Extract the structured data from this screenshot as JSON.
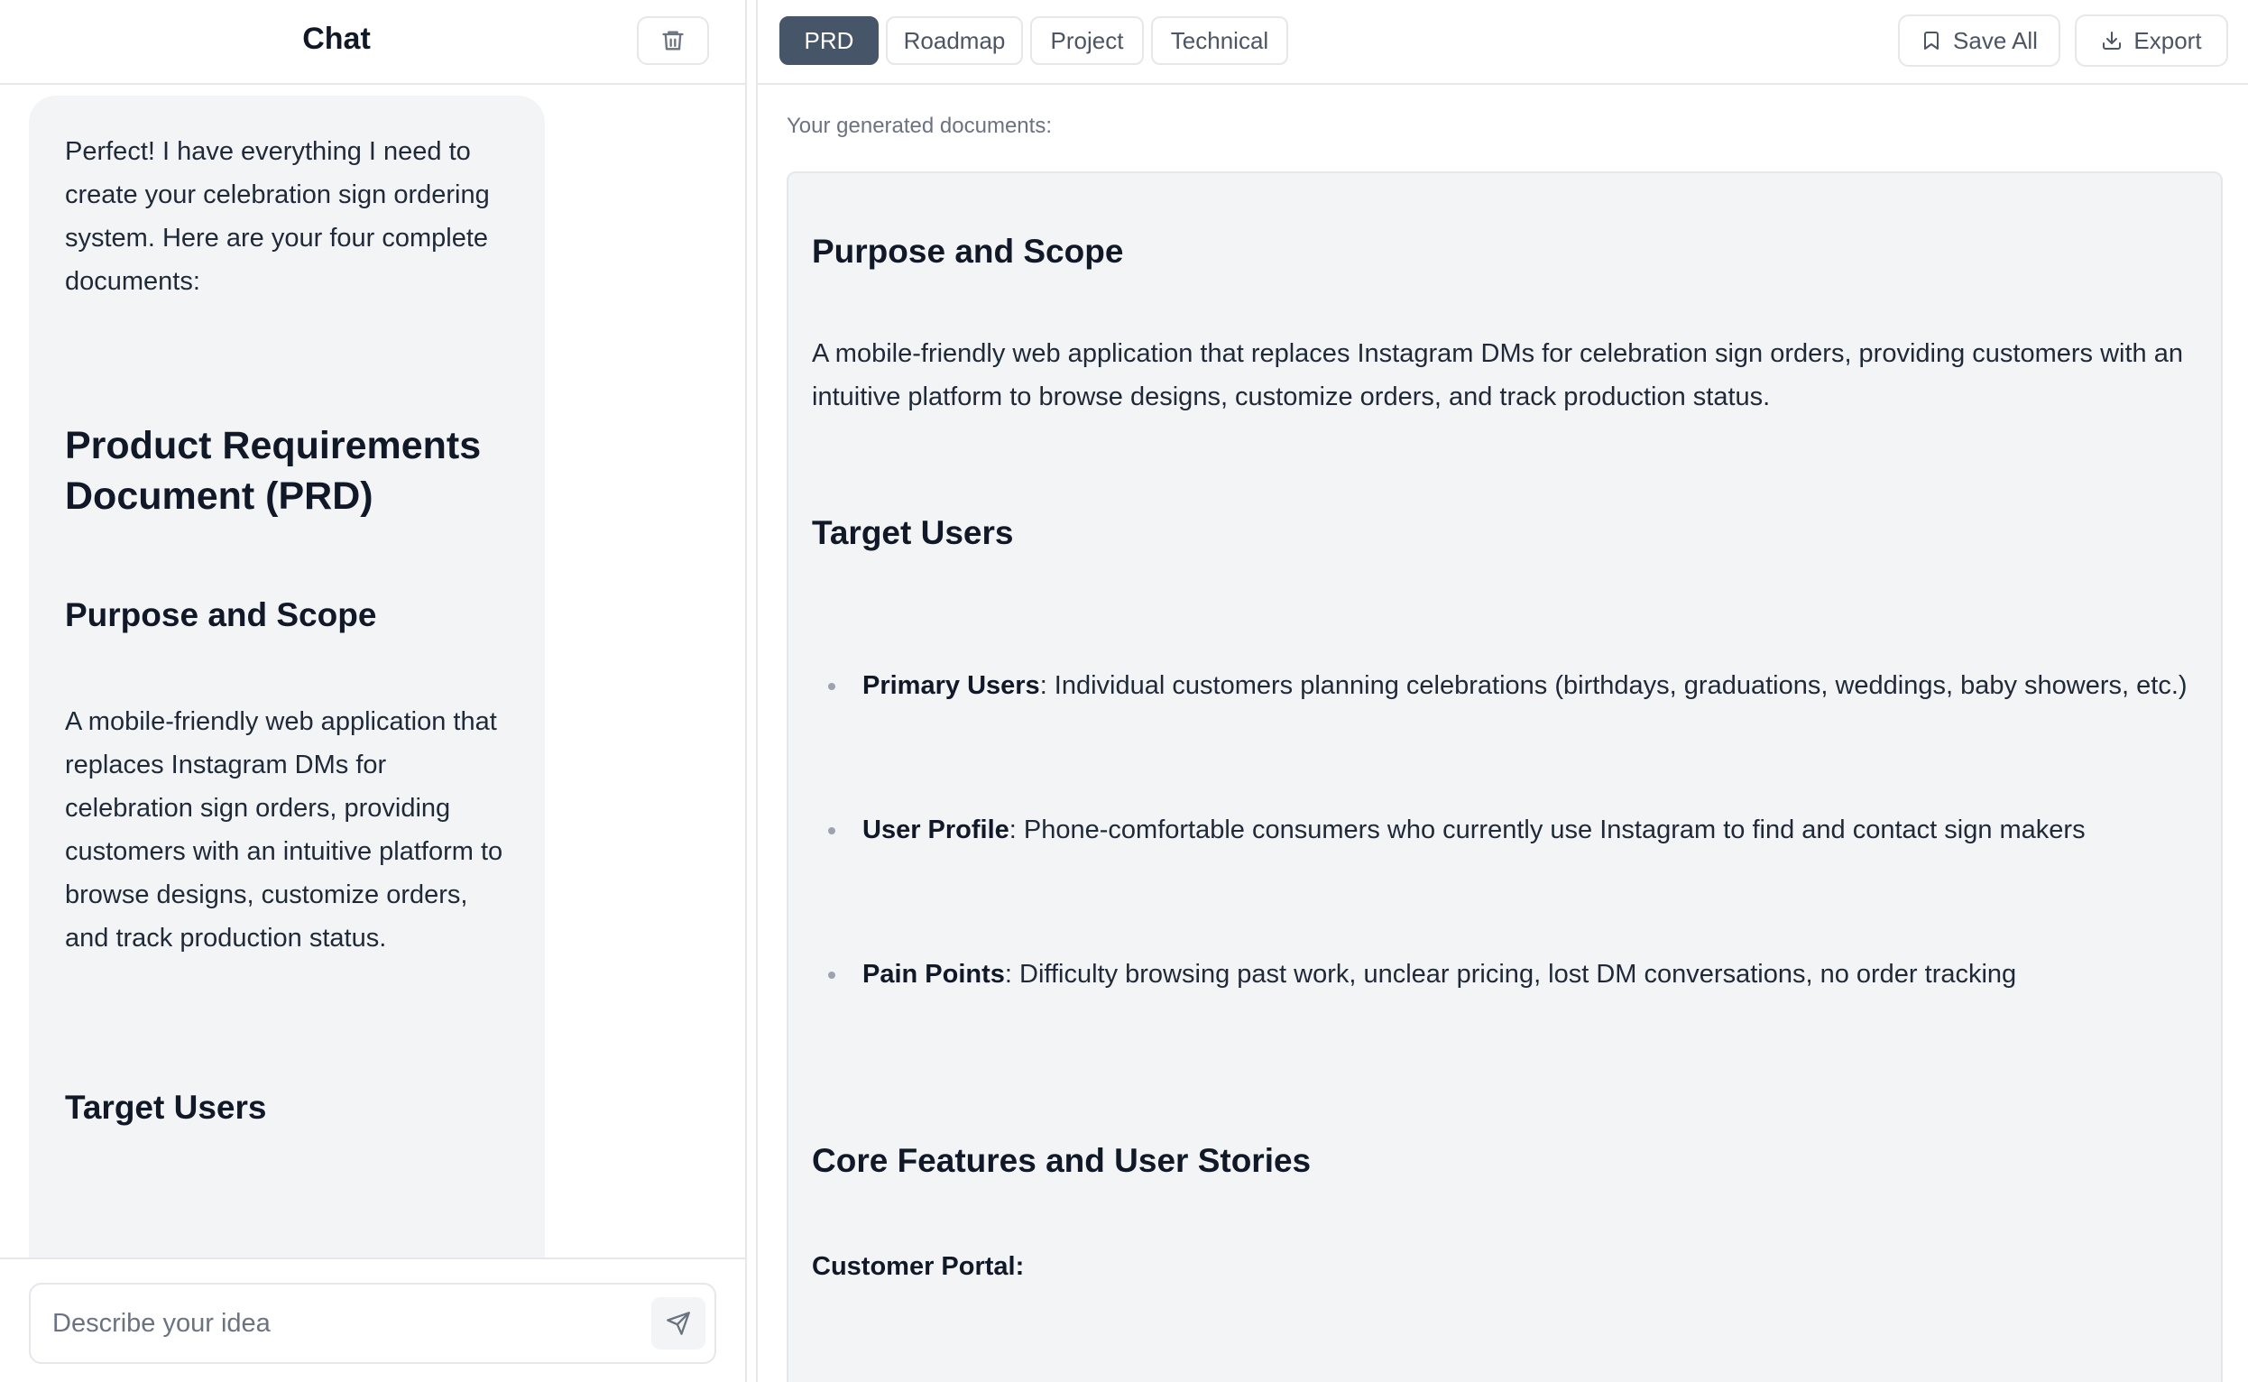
{
  "chat": {
    "title": "Chat",
    "message": {
      "intro": "Perfect! I have everything I need to create your celebration sign ordering system. Here are your four complete documents:",
      "heading": "Product Requirements Document (PRD)",
      "section1_title": "Purpose and Scope",
      "section1_body": "A mobile-friendly web application that replaces Instagram DMs for celebration sign orders, providing customers with an intuitive platform to browse designs, customize orders, and track production status.",
      "section2_title": "Target Users"
    },
    "input_placeholder": "Describe your idea",
    "icons": {
      "clear": "trash-icon",
      "send": "send-icon"
    }
  },
  "documents": {
    "tabs": [
      {
        "label": "PRD",
        "active": true
      },
      {
        "label": "Roadmap",
        "active": false
      },
      {
        "label": "Project",
        "active": false
      },
      {
        "label": "Technical",
        "active": false
      }
    ],
    "save_all_label": "Save All",
    "export_label": "Export",
    "caption": "Your generated documents:",
    "content": {
      "purpose_title": "Purpose and Scope",
      "purpose_body": "A mobile-friendly web application that replaces Instagram DMs for celebration sign orders, providing customers with an intuitive platform to browse designs, customize orders, and track production status.",
      "target_users_title": "Target Users",
      "target_users": [
        {
          "label": "Primary Users",
          "text": ": Individual customers planning celebrations (birthdays, graduations, weddings, baby showers, etc.)"
        },
        {
          "label": "User Profile",
          "text": ": Phone-comfortable consumers who currently use Instagram to find and contact sign makers"
        },
        {
          "label": "Pain Points",
          "text": ": Difficulty browsing past work, unclear pricing, lost DM conversations, no order tracking"
        }
      ],
      "core_features_title": "Core Features and User Stories",
      "customer_portal_label": "Customer Portal:"
    }
  },
  "colors": {
    "active_tab": "#475569",
    "panel_bg": "#f3f4f6",
    "border": "#e5e7eb",
    "muted_text": "#6b7280"
  }
}
